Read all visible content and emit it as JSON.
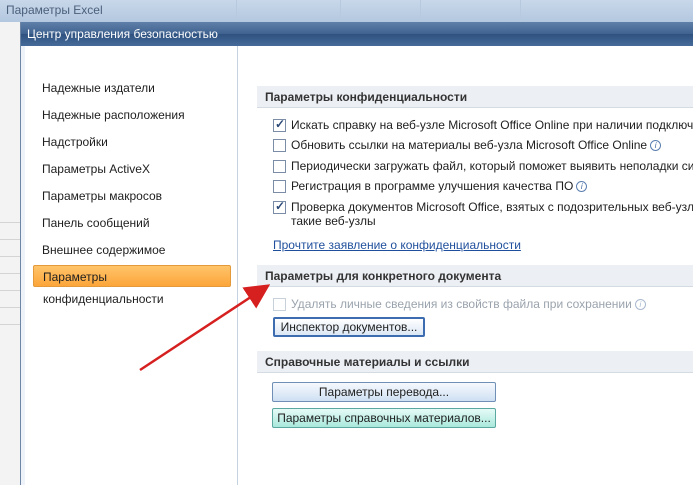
{
  "background_window": {
    "title": "Параметры Excel"
  },
  "dialog": {
    "title": "Центр управления безопасностью",
    "nav_items": [
      {
        "label": "Надежные издатели",
        "active": false
      },
      {
        "label": "Надежные расположения",
        "active": false
      },
      {
        "label": "Надстройки",
        "active": false
      },
      {
        "label": "Параметры ActiveX",
        "active": false
      },
      {
        "label": "Параметры макросов",
        "active": false
      },
      {
        "label": "Панель сообщений",
        "active": false
      },
      {
        "label": "Внешнее содержимое",
        "active": false
      },
      {
        "label": "Параметры конфиденциальности",
        "active": true
      }
    ],
    "privacy_section": {
      "header": "Параметры конфиденциальности",
      "options": [
        {
          "label": "Искать справку на веб-узле Microsoft Office Online при наличии подключения к Интернету",
          "checked": true
        },
        {
          "label": "Обновить ссылки на материалы веб-узла Microsoft Office Online",
          "checked": false,
          "info": true
        },
        {
          "label": "Периодически загружать файл, который поможет выявить неполадки системы",
          "checked": false
        },
        {
          "label": "Регистрация в программе улучшения качества ПО",
          "checked": false,
          "info": true
        },
        {
          "label": "Проверка документов Microsoft Office, взятых с подозрительных веб-узлов или ссылающихся на такие веб-узлы",
          "line1": "Проверка документов Microsoft Office, взятых с подозрительных веб-узлов или ссылающихся на",
          "line2": "такие веб-узлы",
          "checked": true
        }
      ],
      "link": "Прочтите заявление о конфиденциальности"
    },
    "document_section": {
      "header": "Параметры для конкретного документа",
      "option": {
        "label": "Удалять личные сведения из свойств файла при сохранении",
        "checked": false,
        "disabled": true
      },
      "button": "Инспектор документов..."
    },
    "reference_section": {
      "header": "Справочные материалы и ссылки",
      "translate_button": "Параметры перевода...",
      "research_button": "Параметры справочных материалов..."
    }
  },
  "colors": {
    "active_nav": "#fca53a",
    "arrow": "#d62020",
    "link": "#1f4f9c"
  }
}
